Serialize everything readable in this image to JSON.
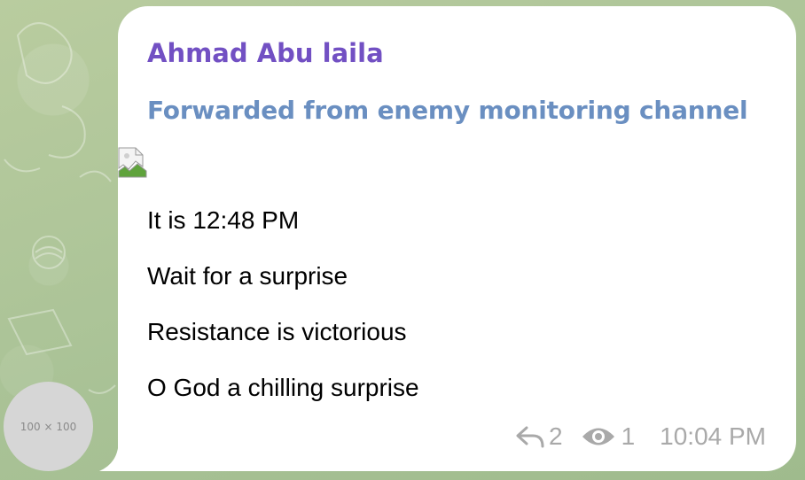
{
  "avatar": {
    "placeholder_text": "100 × 100"
  },
  "message": {
    "sender_name": "Ahmad Abu laila",
    "forwarded_from": "Forwarded from enemy monitoring channel",
    "lines": [
      "It is 12:48 PM",
      "Wait for a surprise",
      "Resistance is victorious",
      "O God a chilling surprise"
    ],
    "reply_count": "2",
    "view_count": "1",
    "time": "10:04 PM"
  },
  "icons": {
    "reply": "reply-arrow-icon",
    "views": "eye-icon",
    "broken_image": "broken-image-icon"
  },
  "colors": {
    "sender_name": "#7250c3",
    "forwarded": "#6a8fc1",
    "meta": "#a9a9a9",
    "bubble": "#ffffff",
    "background": "#b7c99e",
    "avatar": "#d6d6d6"
  }
}
